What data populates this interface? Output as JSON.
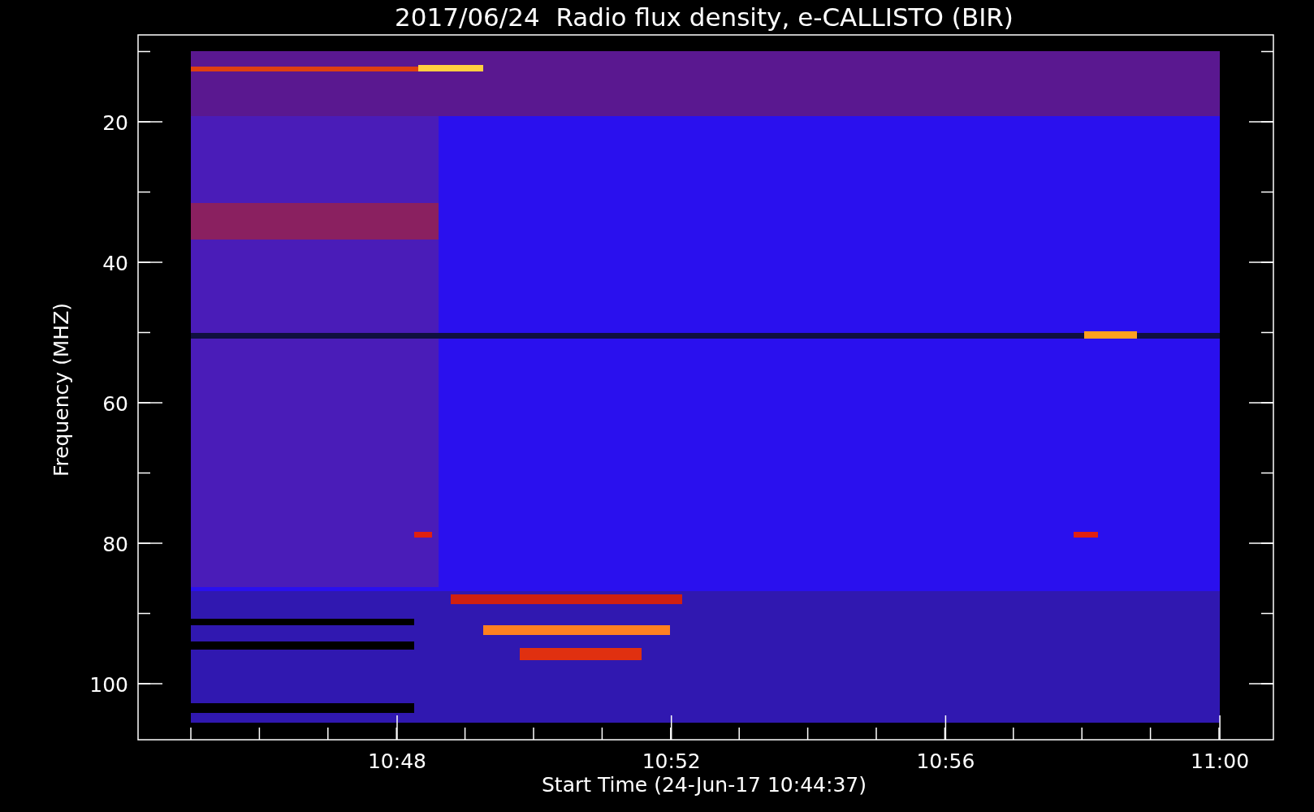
{
  "title": "2017/06/24  Radio flux density, e-CALLISTO (BIR)",
  "y_axis": {
    "label": "Frequency (MHZ)",
    "ticks": [
      "20",
      "40",
      "60",
      "80",
      "100"
    ]
  },
  "x_axis": {
    "label": "Start Time (24-Jun-17 10:44:37)",
    "ticks": [
      "10:48",
      "10:52",
      "10:56",
      "11:00"
    ]
  }
}
